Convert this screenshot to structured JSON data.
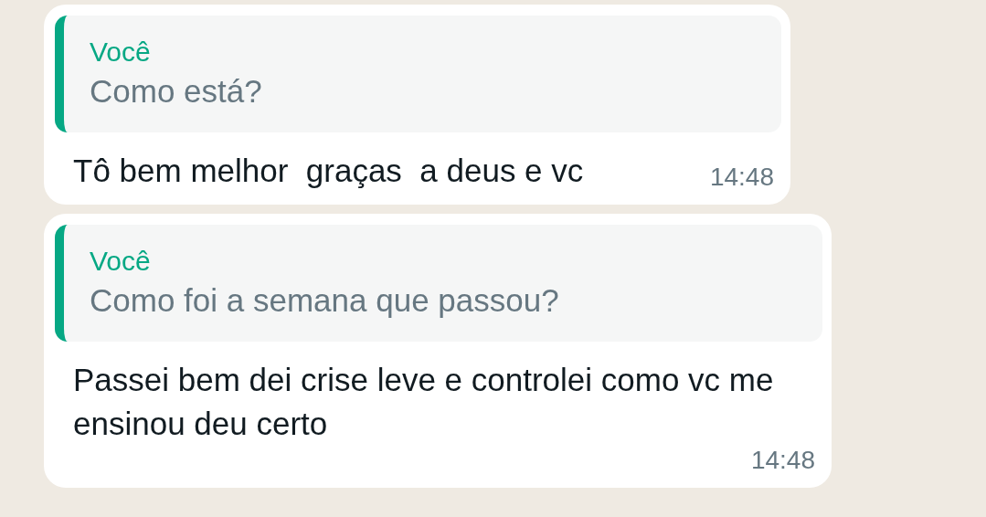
{
  "messages": [
    {
      "quote": {
        "author": "Você",
        "text": "Como está?"
      },
      "text": "Tô bem melhor  graças  a deus e vc",
      "time": "14:48"
    },
    {
      "quote": {
        "author": "Você",
        "text": "Como foi a semana que passou?"
      },
      "text": "Passei bem dei crise leve e controlei como vc me ensinou deu certo",
      "time": "14:48"
    }
  ]
}
